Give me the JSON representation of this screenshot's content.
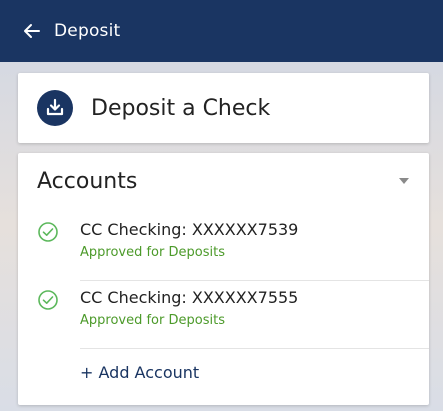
{
  "header": {
    "title": "Deposit",
    "back_icon": "arrow-left-icon"
  },
  "deposit_card": {
    "label": "Deposit a Check",
    "icon": "download-icon"
  },
  "accounts": {
    "title": "Accounts",
    "items": [
      {
        "name": "CC Checking: XXXXXX7539",
        "status": "Approved for Deposits"
      },
      {
        "name": "CC Checking: XXXXXX7555",
        "status": "Approved for Deposits"
      }
    ],
    "add_label": "+ Add Account"
  },
  "colors": {
    "header_bg": "#1a3562",
    "approved_green": "#4c9a2a",
    "check_green": "#5cb85c"
  }
}
